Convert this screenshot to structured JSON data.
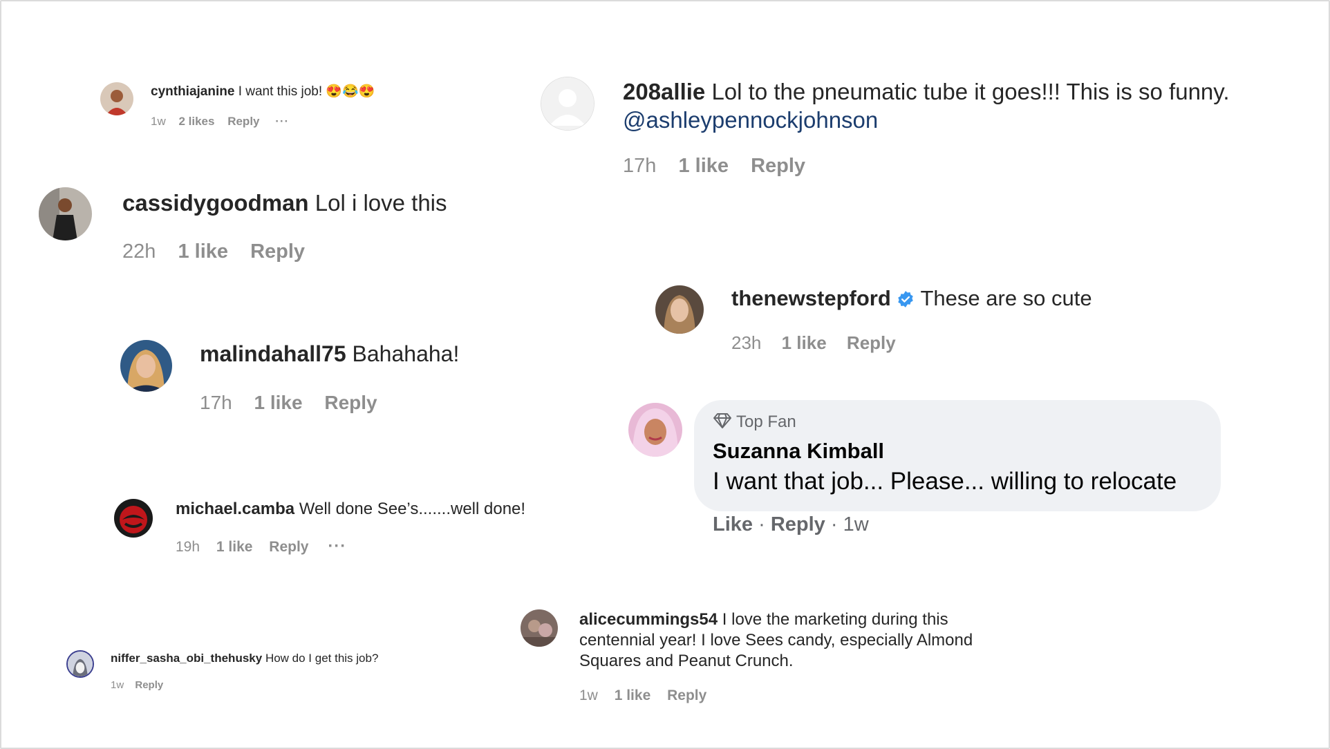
{
  "comments": [
    {
      "user": "cynthiajanine",
      "text": "I want this job! 😍😂😍",
      "time": "1w",
      "likes": "2 likes",
      "reply": "Reply",
      "more": "···"
    },
    {
      "user": "208allie",
      "text": "Lol to the pneumatic tube it goes!!! This is so funny.",
      "mention": "@ashleypennockjohnson",
      "time": "17h",
      "likes": "1 like",
      "reply": "Reply"
    },
    {
      "user": "cassidygoodman",
      "text": "Lol i love this",
      "time": "22h",
      "likes": "1 like",
      "reply": "Reply"
    },
    {
      "user": "thenewstepford",
      "text": "These are so cute",
      "time": "23h",
      "likes": "1 like",
      "reply": "Reply"
    },
    {
      "user": "malindahall75",
      "text": "Bahahaha!",
      "time": "17h",
      "likes": "1 like",
      "reply": "Reply"
    },
    {
      "badge": "Top Fan",
      "user": "Suzanna Kimball",
      "text": "I want that job... Please... willing to relocate",
      "like": "Like",
      "sep1": "·",
      "reply": "Reply",
      "sep2": "·",
      "time": "1w"
    },
    {
      "user": "michael.camba",
      "text": "Well done See’s.......well done!",
      "time": "19h",
      "likes": "1 like",
      "reply": "Reply",
      "more": "···"
    },
    {
      "user": "alicecummings54",
      "text_lines": [
        "I love the marketing during this",
        "centennial year! I love Sees candy, especially Almond",
        "Squares and Peanut Crunch."
      ],
      "time": "1w",
      "likes": "1 like",
      "reply": "Reply"
    },
    {
      "user": "niffer_sasha_obi_thehusky",
      "text": "How do I get this job?",
      "time": "1w",
      "reply": "Reply"
    }
  ],
  "icons": {
    "verified": "verified-badge-icon",
    "top_fan": "diamond-icon",
    "more": "more-options-icon",
    "default_avatar": "default-avatar-icon"
  },
  "colors": {
    "text": "#262626",
    "meta": "#8e8e8e",
    "mention": "#1c3d6e",
    "verified": "#3897f0",
    "bubble": "#eff1f4"
  }
}
